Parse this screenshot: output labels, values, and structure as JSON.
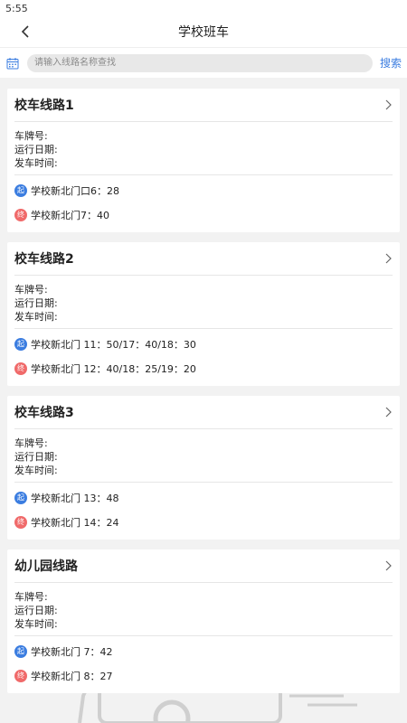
{
  "status": {
    "time": "5:55"
  },
  "header": {
    "title": "学校班车"
  },
  "search": {
    "placeholder": "请输入线路名称查找",
    "button_label": "搜索"
  },
  "labels": {
    "plate": "车牌号:",
    "run_date": "运行日期:",
    "depart_time": "发车时间:",
    "start_badge": "起",
    "end_badge": "终"
  },
  "routes": [
    {
      "name": "校车线路1",
      "start": "学校新北门口6：28",
      "end": "学校新北门7：40"
    },
    {
      "name": "校车线路2",
      "start": "学校新北门 11：50/17：40/18：30",
      "end": "学校新北门 12：40/18：25/19：20"
    },
    {
      "name": "校车线路3",
      "start": "学校新北门 13：48",
      "end": "学校新北门 14：24"
    },
    {
      "name": "幼儿园线路",
      "start": "学校新北门 7：42",
      "end": "学校新北门 8：27"
    }
  ],
  "colors": {
    "accent": "#3b7de0",
    "end_badge": "#f06a6a",
    "background": "#f2f2f2"
  }
}
